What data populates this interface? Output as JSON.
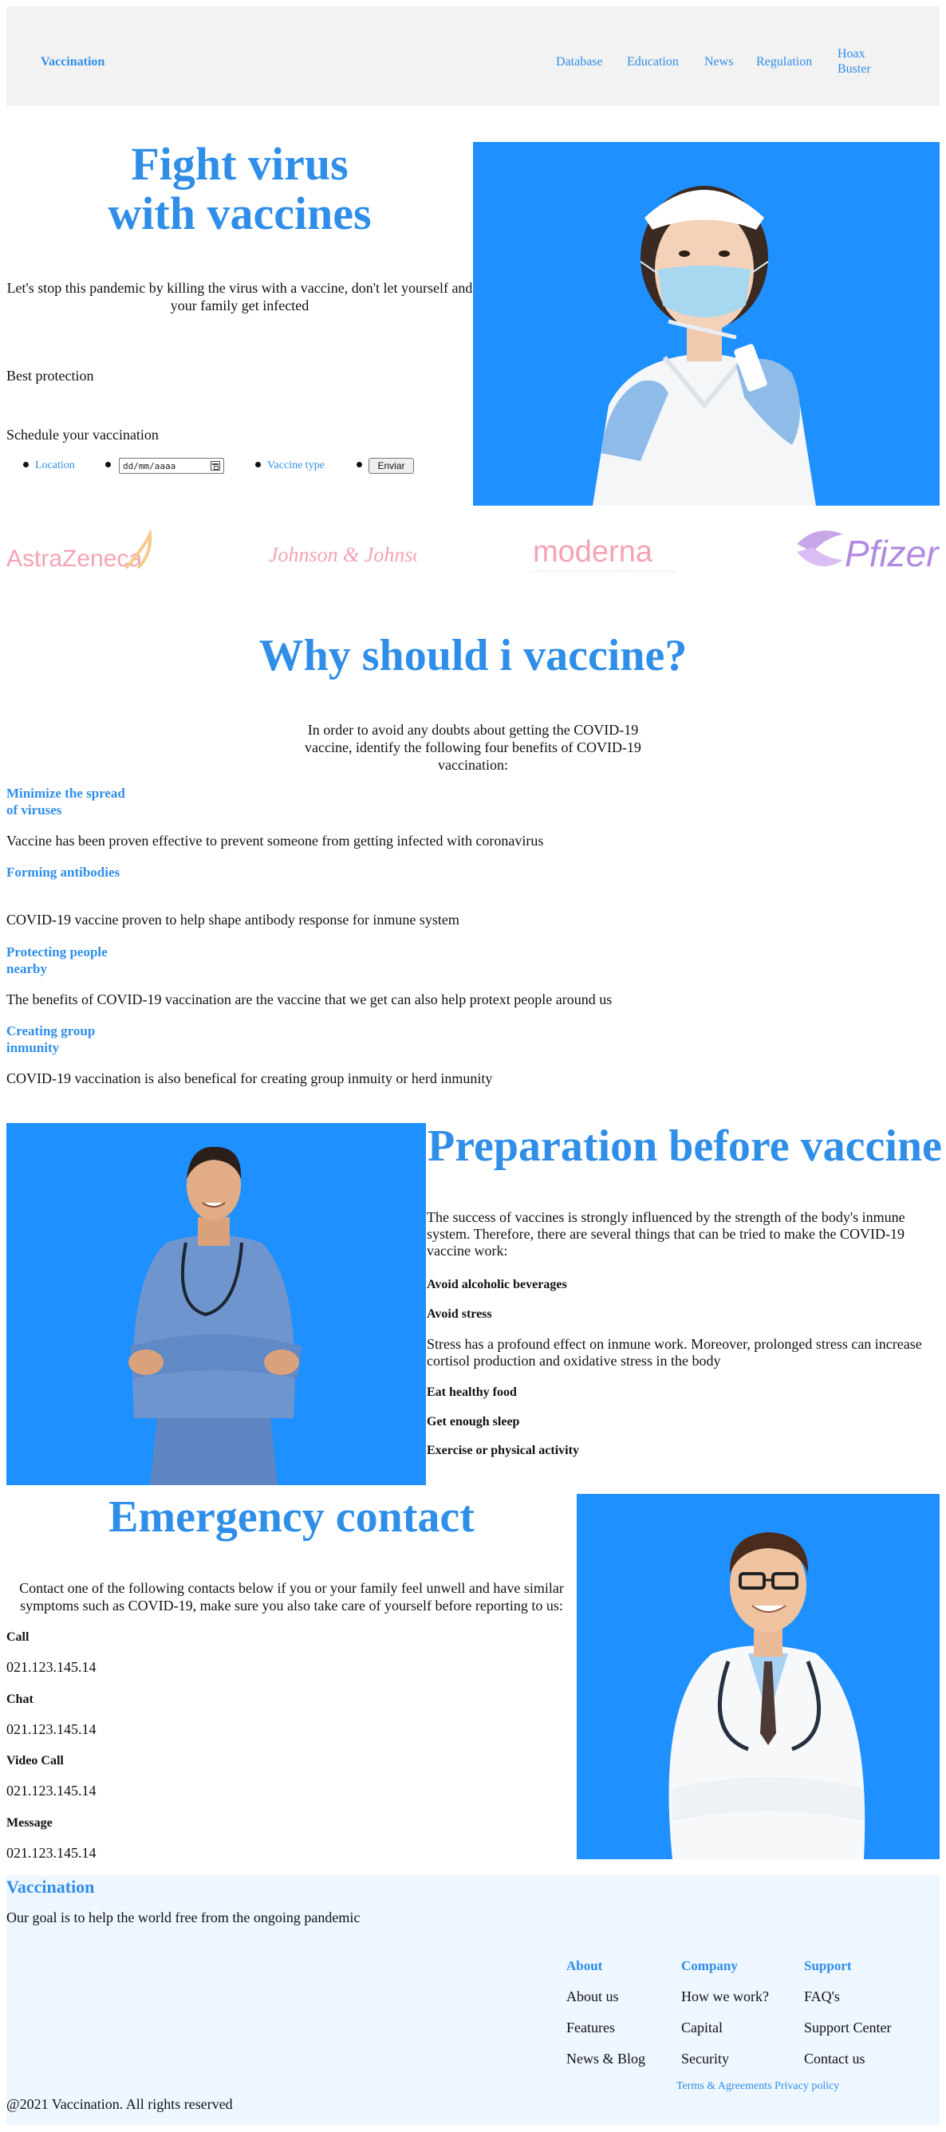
{
  "nav": {
    "brand": "Vaccination",
    "items": [
      "Database",
      "Education",
      "News",
      "Regulation"
    ],
    "hoax": "Hoax Buster"
  },
  "hero": {
    "title_line1": "Fight virus",
    "title_line2": "with vaccines",
    "text": "Let's stop this pandemic by killing the virus with a vaccine, don't let yourself and your family get infected",
    "best": "Best protection",
    "schedule": "Schedule your vaccination",
    "location_label": "Location",
    "date_placeholder": "dd/mm/aaaa",
    "vaccine_type_label": "Vaccine type",
    "submit_label": "Enviar"
  },
  "logos": [
    "AstraZeneca",
    "Johnson & Johnson",
    "moderna",
    "Pfizer"
  ],
  "why": {
    "title": "Why should i vaccine?",
    "intro": "In order to avoid any doubts about getting the COVID-19 vaccine, identify the following four benefits of COVID-19 vaccination:",
    "benefits": [
      {
        "title": "Minimize the spread of viruses",
        "text": "Vaccine has been proven effective to prevent someone from getting infected with coronavirus"
      },
      {
        "title": "Forming antibodies",
        "text": "COVID-19 vaccine proven to help shape antibody response for inmune system"
      },
      {
        "title": "Protecting people nearby",
        "text": "The benefits of COVID-19 vaccination are the vaccine that we get can also help protext people around us"
      },
      {
        "title": "Creating group inmunity",
        "text": "COVID-19 vaccination is also benefical for creating group inmuity or herd inmunity"
      }
    ]
  },
  "prep": {
    "title": "Preparation before vaccine",
    "intro": "The success of vaccines is strongly influenced by the strength of the body's inmune system. Therefore, there are several things that can be tried to make the COVID-19 vaccine work:",
    "item1": "Avoid alcoholic beverages",
    "item2": "Avoid stress",
    "stress_text": "Stress has a profound effect on inmune work. Moreover, prolonged stress can increase cortisol production and oxidative stress in the body",
    "item3": "Eat healthy food",
    "item4": "Get enough sleep",
    "item5": "Exercise or physical activity"
  },
  "emergency": {
    "title": "Emergency contact",
    "text": "Contact one of the following contacts below if you or your family feel unwell and have similar symptoms such as COVID-19, make sure you also take care of yourself before reporting to us:",
    "contacts": [
      {
        "label": "Call",
        "value": "021.123.145.14"
      },
      {
        "label": "Chat",
        "value": "021.123.145.14"
      },
      {
        "label": "Video Call",
        "value": "021.123.145.14"
      },
      {
        "label": "Message",
        "value": "021.123.145.14"
      }
    ]
  },
  "footer": {
    "brand": "Vaccination",
    "goal": "Our goal is to help the world free from the ongoing pandemic",
    "about_h": "About",
    "about": [
      "About us",
      "Features",
      "News & Blog"
    ],
    "company_h": "Company",
    "company": [
      "How we work?",
      "Capital",
      "Security"
    ],
    "support_h": "Support",
    "support": [
      "FAQ's",
      "Support Center",
      "Contact us"
    ],
    "terms": "Terms & Agreements",
    "privacy": "Privacy policy",
    "copyright": "@2021 Vaccination. All rights reserved"
  },
  "colors": {
    "accent": "#2f8ee8",
    "image_bg": "#1e90ff",
    "nav_bg": "#f2f2f2",
    "footer_bg": "#eef6ff"
  }
}
